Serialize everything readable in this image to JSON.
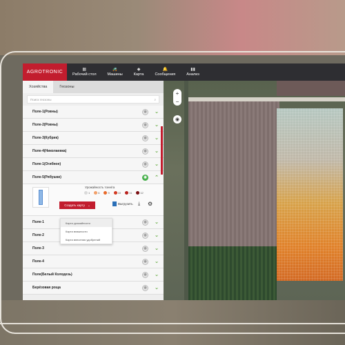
{
  "app": {
    "logo": "AGROTRONIC"
  },
  "nav": [
    {
      "icon": "▦",
      "label": "Рабочий стол"
    },
    {
      "icon": "🚜",
      "label": "Машины"
    },
    {
      "icon": "◆",
      "label": "Карта"
    },
    {
      "icon": "🔔",
      "label": "Сообщения"
    },
    {
      "icon": "▮▮",
      "label": "Анализ"
    }
  ],
  "tabs": [
    "Хозяйства",
    "Геозоны"
  ],
  "search": {
    "placeholder": "Поиск геозоны",
    "icon": "search-icon"
  },
  "fields_before": [
    "Поле-1(Ровны)",
    "Поле-2(Ровны)",
    "Поле-3(Кубрик)",
    "Поле-4(Николаевка)",
    "Поле-1(Огибное)"
  ],
  "expanded_field": {
    "name": "Поле-5(Рябушки)",
    "yield_title": "Урожайность тонн/га",
    "legend": [
      {
        "value": "1",
        "color": "#d9d9d9"
      },
      {
        "value": "6",
        "color": "#f2a06a"
      },
      {
        "value": "9",
        "color": "#e86a2a"
      },
      {
        "value": "10",
        "color": "#d23a22"
      },
      {
        "value": "11",
        "color": "#b8201c"
      },
      {
        "value": "12",
        "color": "#7a0f12"
      }
    ],
    "create_label": "Создать карту",
    "export_label": "Выгрузить"
  },
  "dropdown": [
    "Карта урожайности",
    "Карта влажности",
    "Карта внесения удобрений"
  ],
  "fields_after": [
    "Поле-1",
    "Поле-2",
    "Поле-3",
    "Поле-4",
    "Поле(Белый Колодезь)",
    "Берёзовая роща"
  ],
  "map": {
    "zoom_in": "+",
    "zoom_out": "−",
    "locate": "◉"
  }
}
